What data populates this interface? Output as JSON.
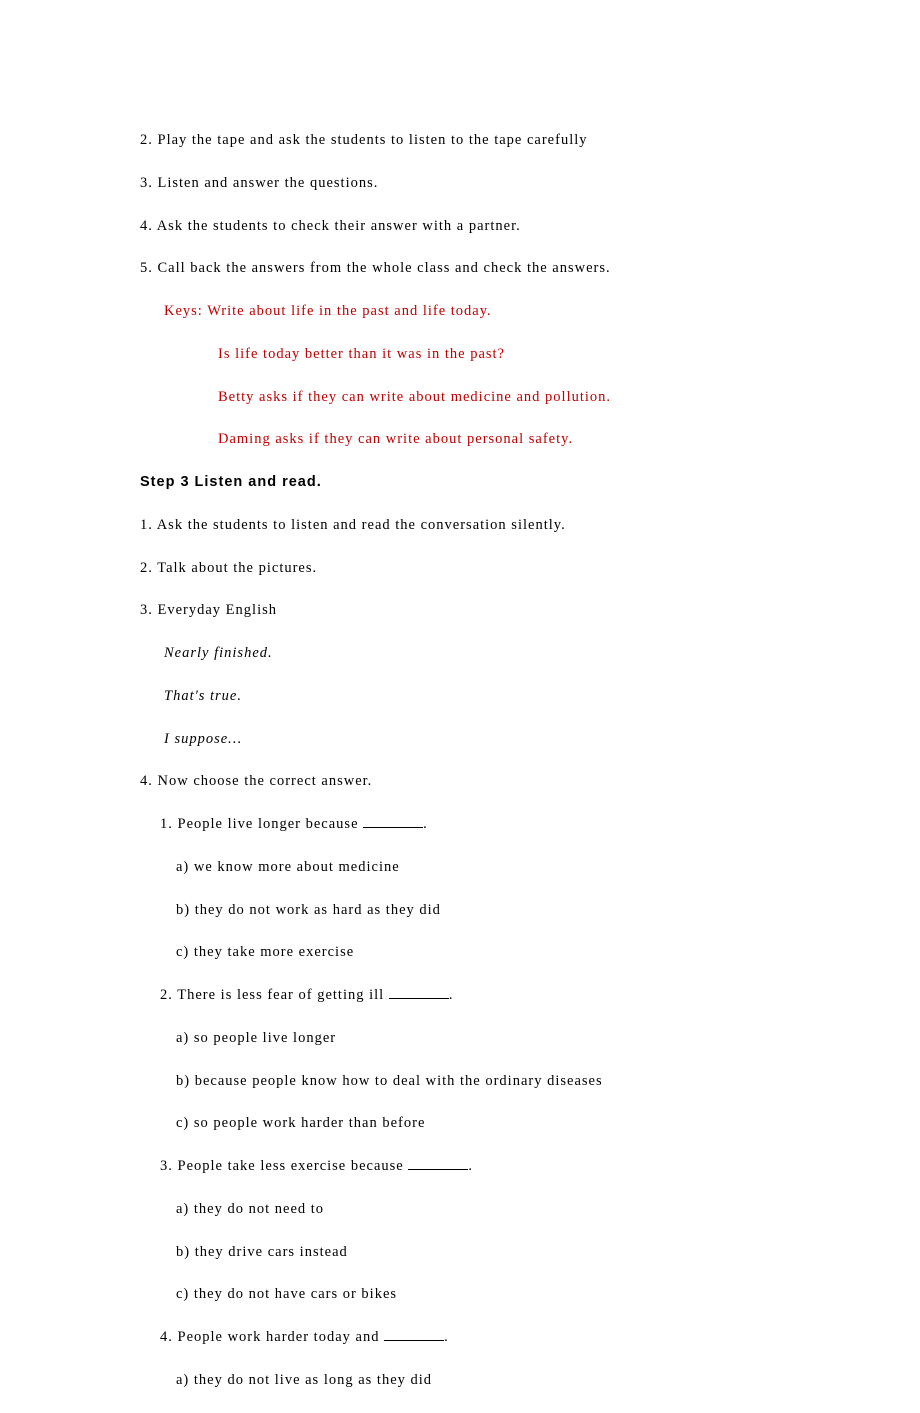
{
  "intro": [
    "2. Play the tape and ask the students to listen to the tape carefully",
    "3. Listen and answer the questions.",
    "4. Ask the students to check their answer with a partner.",
    "5. Call back the answers from the whole class and check the answers."
  ],
  "keys": {
    "lead": "Keys: Write about life in the past and life today.",
    "rest": [
      "Is life today better than it was in the past?",
      "Betty asks if they can write about medicine and pollution.",
      "Daming asks if they can write about personal safety."
    ]
  },
  "step3_title": "Step 3 Listen and read.",
  "step3_items": [
    "1. Ask the students to listen and read the conversation silently.",
    "2. Talk about the pictures.",
    "3. Everyday English"
  ],
  "everyday": [
    "Nearly finished.",
    "That's true.",
    "I suppose…"
  ],
  "q_lead": "4. Now choose the correct answer.",
  "questions": [
    {
      "q_pre": "1. People live longer because ",
      "q_post": ".",
      "opts": [
        "a) we know more about medicine",
        "b) they do not work as hard as they did",
        "c) they take more exercise"
      ]
    },
    {
      "q_pre": "2. There is less fear of getting ill ",
      "q_post": ".",
      "opts": [
        "a) so people live longer",
        "b) because people know how to deal with the ordinary diseases",
        "c) so people work harder than before"
      ]
    },
    {
      "q_pre": "3. People take less exercise because ",
      "q_post": ".",
      "opts": [
        "a) they do not need to",
        "b) they drive cars instead",
        "c) they do not have cars or bikes"
      ]
    },
    {
      "q_pre": "4. People work harder today and ",
      "q_post": ".",
      "opts": [
        "a) they do not live as long as they did"
      ]
    }
  ]
}
